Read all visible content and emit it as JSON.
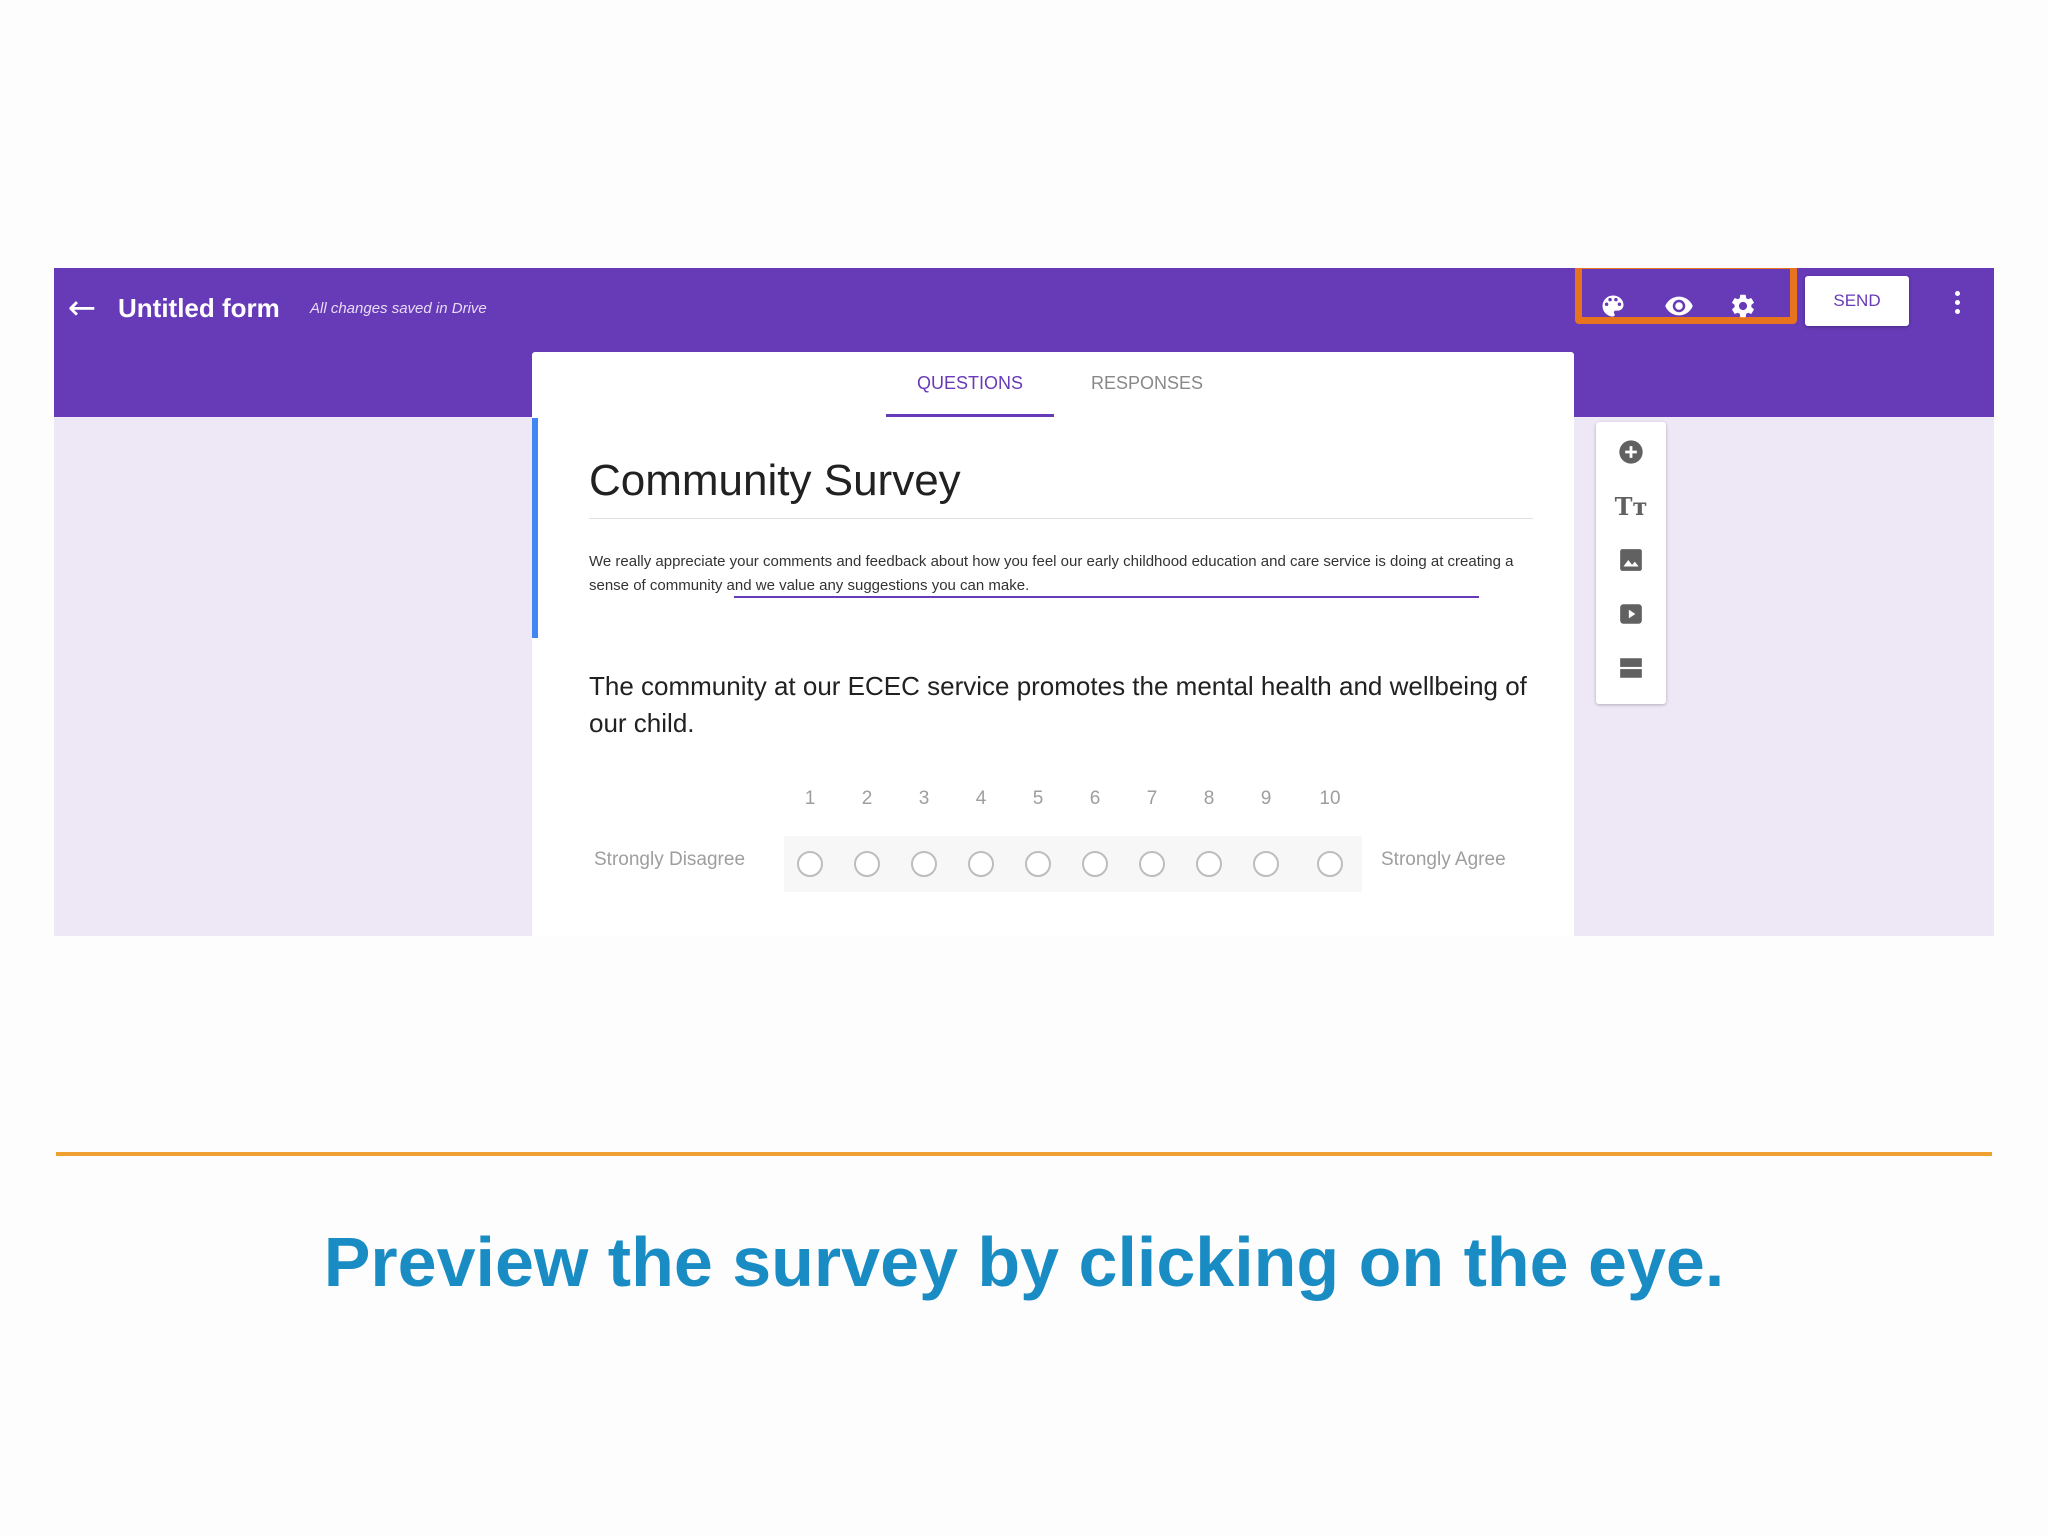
{
  "header": {
    "back_icon": "arrow-back-icon",
    "form_title": "Untitled form",
    "save_status": "All changes saved in Drive",
    "icons": [
      "palette-icon",
      "eye-icon",
      "gear-icon"
    ],
    "send_label": "SEND",
    "more_icon": "more-vert-icon",
    "highlight_color": "#e8731e",
    "bar_color": "#673ab7"
  },
  "tabs": [
    {
      "label": "QUESTIONS",
      "active": true
    },
    {
      "label": "RESPONSES",
      "active": false
    }
  ],
  "form": {
    "title": "Community Survey",
    "description": "We really appreciate your comments and feedback about how you feel our early childhood education and care service is doing at creating a sense of community and we value any suggestions you can make.",
    "question": {
      "text": "The community at our ECEC service promotes the mental health and wellbeing of our child.",
      "scale": [
        "1",
        "2",
        "3",
        "4",
        "5",
        "6",
        "7",
        "8",
        "9",
        "10"
      ],
      "low_label": "Strongly Disagree",
      "high_label": "Strongly Agree"
    }
  },
  "side_toolbar": [
    "add-question-icon",
    "title-text-icon",
    "image-icon",
    "video-icon",
    "section-icon"
  ],
  "caption": {
    "text": "Preview the survey by clicking on the eye.",
    "color": "#1a8cc4",
    "divider_color": "#f0a030"
  }
}
